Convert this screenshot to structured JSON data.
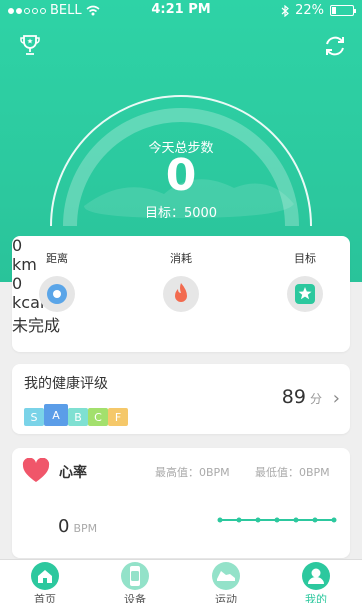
{
  "status_bar": {
    "carrier": "BELL",
    "time": "4:21 PM",
    "battery": "22%",
    "battery_level": 0.22
  },
  "header": {
    "trophy_icon": "trophy-icon",
    "sync_icon": "refresh-icon"
  },
  "steps": {
    "label": "今天总步数",
    "value": "0",
    "goal_text": "目标：5000"
  },
  "stats": [
    {
      "title": "距离",
      "icon": "location-icon",
      "value": "0",
      "unit": "km"
    },
    {
      "title": "消耗",
      "icon": "flame-icon",
      "value": "0",
      "unit": "kcal"
    },
    {
      "title": "目标",
      "icon": "star-badge-icon",
      "value": "未完成",
      "unit": ""
    }
  ],
  "health_rating": {
    "title": "我的健康评级",
    "grades": [
      "S",
      "A",
      "B",
      "C",
      "F"
    ],
    "selected_grade": "A",
    "score": "89",
    "score_unit": "分"
  },
  "heart_rate": {
    "title": "心率",
    "max_label": "最高值：0BPM",
    "min_label": "最低值：0BPM",
    "current_value": "0",
    "current_unit": "BPM"
  },
  "tabs": [
    {
      "label": "首页",
      "icon": "home-icon"
    },
    {
      "label": "设备",
      "icon": "watch-icon"
    },
    {
      "label": "运动",
      "icon": "sneaker-icon"
    },
    {
      "label": "我的",
      "icon": "user-icon"
    }
  ],
  "colors": {
    "accent": "#2cc89e",
    "grade_S": "#7ad3e8",
    "grade_A": "#5b9de8",
    "grade_B": "#7fe0d2",
    "grade_C": "#a3e06d",
    "grade_F": "#f5c86a"
  }
}
